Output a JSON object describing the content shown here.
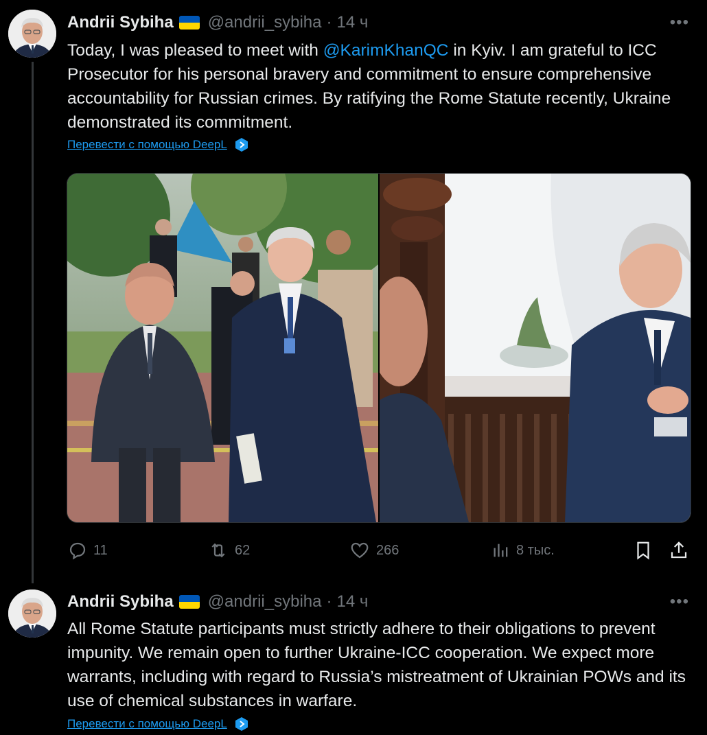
{
  "tweets": [
    {
      "author": {
        "name": "Andrii Sybiha",
        "handle": "@andrii_sybiha",
        "time": "14 ч",
        "flag_colors": [
          "#0057b7",
          "#ffd700"
        ]
      },
      "text_parts": {
        "before_mention": "Today, I was pleased to meet with ",
        "mention": "@KarimKhanQC",
        "after_mention": " in Kyiv. I am grateful to ICC Prosecutor for his personal bravery and commitment to ensure comprehensive accountability for Russian crimes. By ratifying the Rome Statute recently, Ukraine demonstrated its commitment."
      },
      "translate_label": "Перевести с помощью DeepL",
      "stats": {
        "replies": "11",
        "reposts": "62",
        "likes": "266",
        "views": "8 тыс."
      }
    },
    {
      "author": {
        "name": "Andrii Sybiha",
        "handle": "@andrii_sybiha",
        "time": "14 ч"
      },
      "text": "All Rome Statute participants must strictly adhere to their obligations to prevent impunity. We remain open to further Ukraine-ICC cooperation. We expect more warrants, including with regard to Russia’s mistreatment of Ukrainian POWs and its use of chemical substances in warfare.",
      "translate_label": "Перевести с помощью DeepL"
    }
  ],
  "more_label": "•••",
  "separator": "·",
  "icons": [
    "more-icon",
    "reply-icon",
    "repost-icon",
    "like-icon",
    "views-icon",
    "bookmark-icon",
    "share-icon",
    "deepl-icon"
  ],
  "colors": {
    "background": "#000000",
    "text": "#e7e9ea",
    "muted": "#71767b",
    "link": "#1d9bf0",
    "border": "#2f3336"
  }
}
